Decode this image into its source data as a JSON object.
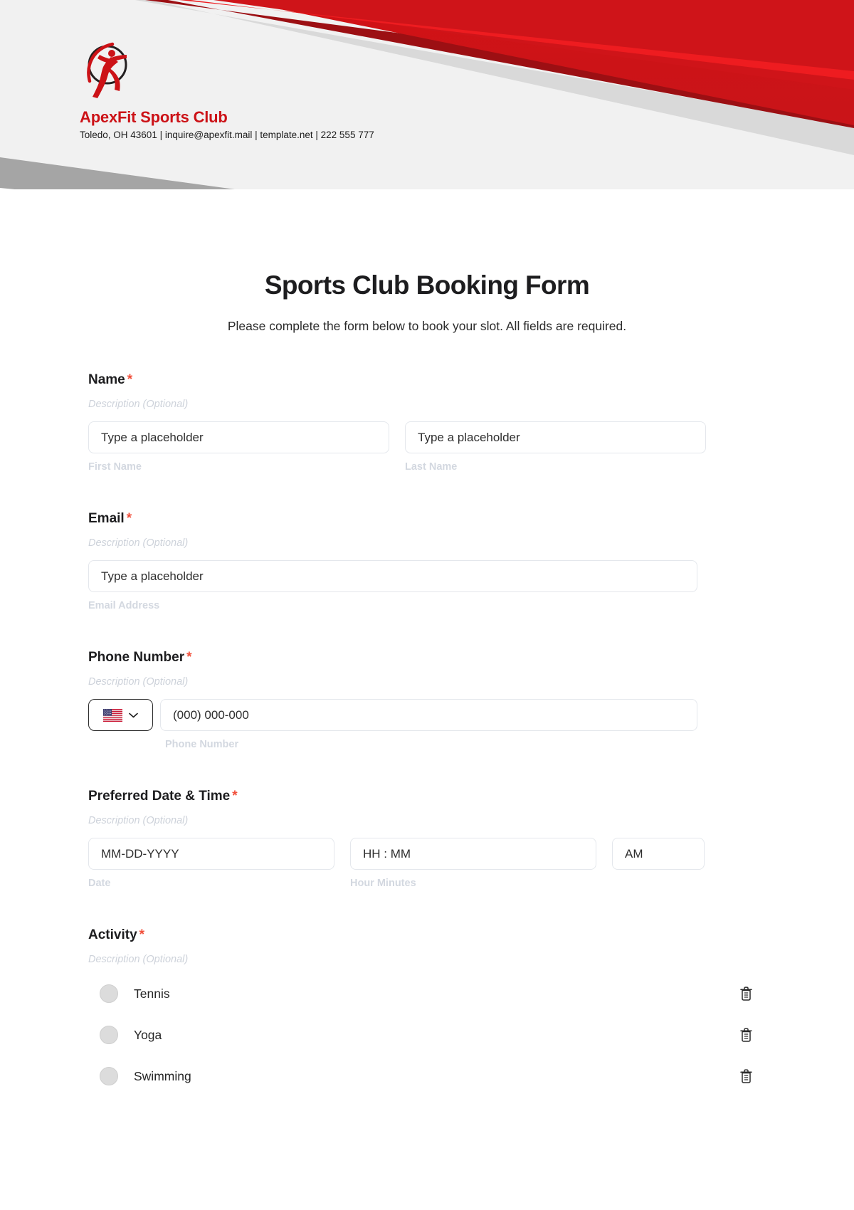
{
  "brand": {
    "logo_icon": "running-athlete-logo-icon",
    "name": "ApexFit Sports Club",
    "contact": "Toledo, OH 43601 | inquire@apexfit.mail | template.net | 222 555 777",
    "accent_color": "#cc1217",
    "dark_accent_color": "#9c0f13",
    "light_plate_color": "#f1f1f1"
  },
  "form": {
    "title": "Sports Club Booking Form",
    "subtitle": "Please complete the form below to book your slot. All fields are required.",
    "required_marker": "*",
    "description_placeholder": "Description (Optional)",
    "fields": {
      "name": {
        "label": "Name",
        "description": "Description (Optional)",
        "first": {
          "placeholder": "Type a placeholder",
          "sub_label": "First Name"
        },
        "last": {
          "placeholder": "Type a placeholder",
          "sub_label": "Last Name"
        }
      },
      "email": {
        "label": "Email",
        "description": "Description (Optional)",
        "placeholder": "Type a placeholder",
        "sub_label": "Email Address"
      },
      "phone": {
        "label": "Phone Number",
        "description": "Description (Optional)",
        "country_flag_icon": "us-flag-icon",
        "dropdown_icon": "chevron-down-icon",
        "placeholder": "(000) 000-000",
        "sub_label": "Phone Number"
      },
      "datetime": {
        "label": "Preferred Date & Time",
        "description": "Description (Optional)",
        "date": {
          "placeholder": "MM-DD-YYYY",
          "sub_label": "Date"
        },
        "time": {
          "placeholder": "HH : MM",
          "sub_label": "Hour Minutes"
        },
        "meridiem": {
          "value": "AM"
        }
      },
      "activity": {
        "label": "Activity",
        "description": "Description (Optional)",
        "delete_icon": "trash-icon",
        "options": [
          {
            "label": "Tennis",
            "selected": false
          },
          {
            "label": "Yoga",
            "selected": false
          },
          {
            "label": "Swimming",
            "selected": false
          }
        ]
      }
    }
  }
}
